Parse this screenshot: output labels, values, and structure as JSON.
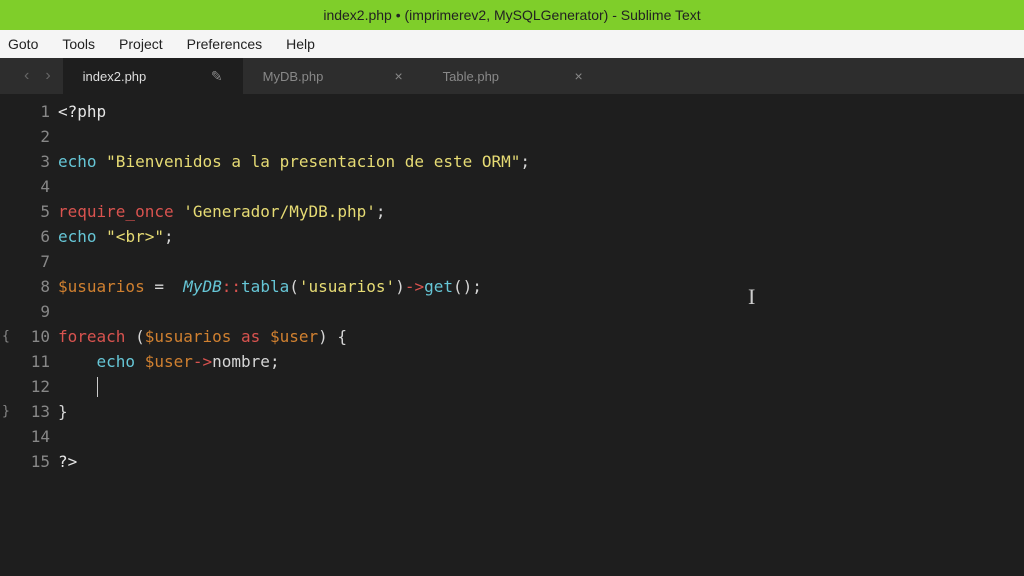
{
  "window": {
    "title": "index2.php • (imprimerev2, MySQLGenerator) - Sublime Text"
  },
  "menu": {
    "items": [
      "Goto",
      "Tools",
      "Project",
      "Preferences",
      "Help"
    ]
  },
  "tabs": [
    {
      "label": "index2.php",
      "active": true,
      "dirty": true
    },
    {
      "label": "MyDB.php",
      "active": false,
      "dirty": false
    },
    {
      "label": "Table.php",
      "active": false,
      "dirty": false
    }
  ],
  "nav": {
    "back": "‹",
    "forward": "›"
  },
  "gutter": {
    "foldOpen10": "{",
    "foldClose13": "}"
  },
  "code": {
    "l1_open": "<?php",
    "l3_echo": "echo",
    "l3_str": "\"Bienvenidos a la presentacion de este ORM\"",
    "l3_semi": ";",
    "l5_req": "require_once",
    "l5_str": "'Generador/MyDB.php'",
    "l5_semi": ";",
    "l6_echo": "echo",
    "l6_str": "\"<br>\"",
    "l6_semi": ";",
    "l8_var": "$usuarios",
    "l8_eq": " = ",
    "l8_cls": "MyDB",
    "l8_scope": "::",
    "l8_fn1": "tabla",
    "l8_p1": "(",
    "l8_arg": "'usuarios'",
    "l8_p2": ")",
    "l8_arrow": "->",
    "l8_fn2": "get",
    "l8_p3": "()",
    "l8_semi": ";",
    "l10_foreach": "foreach",
    "l10_p1": " (",
    "l10_v1": "$usuarios",
    "l10_as": " as ",
    "l10_v2": "$user",
    "l10_p2": ") {",
    "l11_echo": "echo",
    "l11_var": "$user",
    "l11_arrow": "->",
    "l11_prop": "nombre",
    "l11_semi": ";",
    "l13_close": "}",
    "l15_close": "?>"
  },
  "cursor": {
    "glyph": "I"
  }
}
